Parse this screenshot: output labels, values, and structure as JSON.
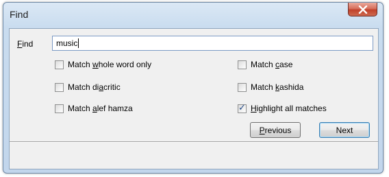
{
  "window": {
    "title": "Find",
    "close_icon": "close-x-icon"
  },
  "find": {
    "label": "Find",
    "mnemonic": "F",
    "value": "music"
  },
  "options": [
    {
      "before": "Match ",
      "mnemonic": "w",
      "after": "hole word only",
      "checked": false
    },
    {
      "before": "Match ",
      "mnemonic": "c",
      "after": "ase",
      "checked": false
    },
    {
      "before": "Match di",
      "mnemonic": "a",
      "after": "critic",
      "checked": false
    },
    {
      "before": "Match ",
      "mnemonic": "k",
      "after": "ashida",
      "checked": false
    },
    {
      "before": "Match ",
      "mnemonic": "a",
      "after": "lef hamza",
      "checked": false
    },
    {
      "before": "",
      "mnemonic": "H",
      "after": "ighlight all matches",
      "checked": true
    }
  ],
  "buttons": {
    "previous": {
      "mnemonic": "P",
      "rest": "revious"
    },
    "next": {
      "label": "Next"
    }
  },
  "colors": {
    "close_button": "#c9452f",
    "check_mark": "#2a4f8a"
  }
}
